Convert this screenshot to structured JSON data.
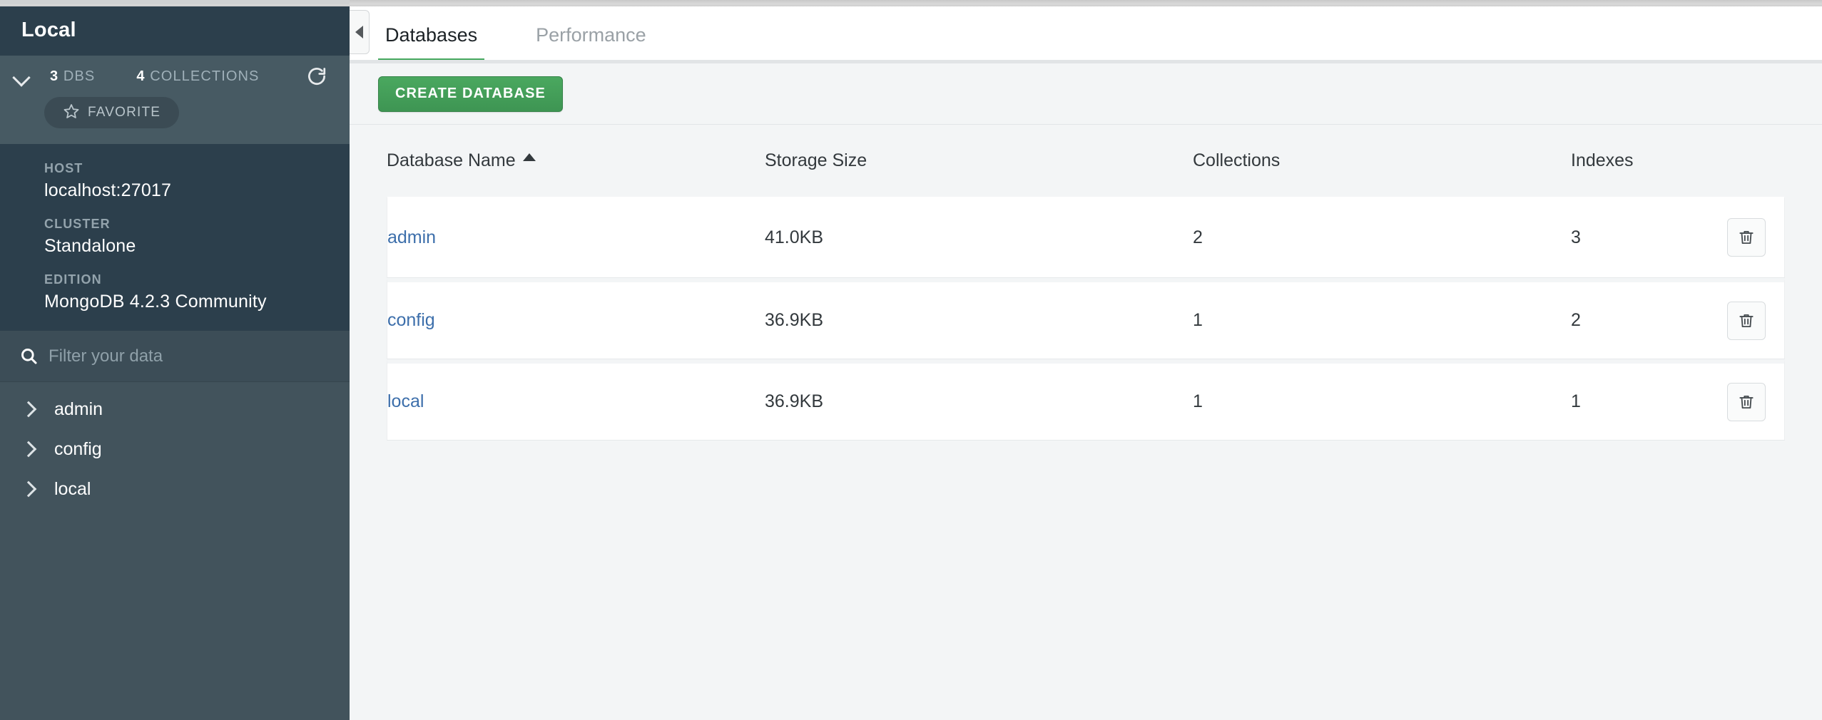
{
  "sidebar": {
    "title": "Local",
    "stats": {
      "dbs_count": "3",
      "dbs_label": "DBS",
      "collections_count": "4",
      "collections_label": "COLLECTIONS",
      "refresh_icon": "refresh-icon",
      "collapse_icon": "chevron-down-icon"
    },
    "favorite": {
      "label": "FAVORITE",
      "icon": "star-icon"
    },
    "info": [
      {
        "label": "HOST",
        "value": "localhost:27017"
      },
      {
        "label": "CLUSTER",
        "value": "Standalone"
      },
      {
        "label": "EDITION",
        "value": "MongoDB 4.2.3 Community"
      }
    ],
    "filter": {
      "placeholder": "Filter your data",
      "value": "",
      "icon": "search-icon"
    },
    "tree": [
      {
        "label": "admin",
        "icon": "chevron-right-icon"
      },
      {
        "label": "config",
        "icon": "chevron-right-icon"
      },
      {
        "label": "local",
        "icon": "chevron-right-icon"
      }
    ]
  },
  "main": {
    "collapse_sidebar_icon": "chevron-left-icon",
    "tabs": [
      {
        "label": "Databases",
        "active": true
      },
      {
        "label": "Performance",
        "active": false
      }
    ],
    "toolbar": {
      "create_database_label": "CREATE DATABASE"
    },
    "table": {
      "columns": [
        {
          "label": "Database Name",
          "sort": "asc"
        },
        {
          "label": "Storage Size",
          "sort": ""
        },
        {
          "label": "Collections",
          "sort": ""
        },
        {
          "label": "Indexes",
          "sort": ""
        }
      ],
      "rows": [
        {
          "name": "admin",
          "storage_size": "41.0KB",
          "collections": "2",
          "indexes": "3",
          "delete_icon": "trash-icon"
        },
        {
          "name": "config",
          "storage_size": "36.9KB",
          "collections": "1",
          "indexes": "2",
          "delete_icon": "trash-icon"
        },
        {
          "name": "local",
          "storage_size": "36.9KB",
          "collections": "1",
          "indexes": "1",
          "delete_icon": "trash-icon"
        }
      ]
    }
  },
  "colors": {
    "sidebar_bg": "#42535c",
    "sidebar_dark": "#2c3f4c",
    "sidebar_stats_bg": "#475a63",
    "accent_green": "#45a85e",
    "link_blue": "#3d6fab",
    "main_bg": "#f3f5f6"
  }
}
